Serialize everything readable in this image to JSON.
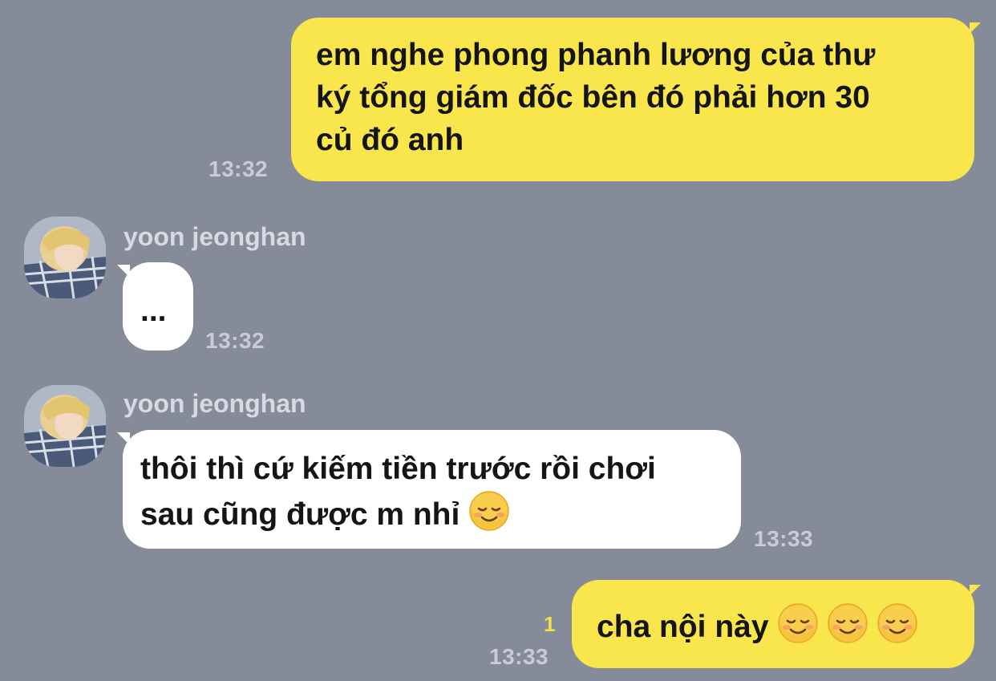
{
  "messages": [
    {
      "id": "m1",
      "direction": "outgoing",
      "text": "em nghe phong phanh lương của thư\nký tổng giám đốc bên đó phải hơn 30\ncủ đó anh",
      "time": "13:32"
    },
    {
      "id": "m2",
      "direction": "incoming",
      "sender": "yoon jeonghan",
      "text": "...",
      "time": "13:32"
    },
    {
      "id": "m3",
      "direction": "incoming",
      "sender": "yoon jeonghan",
      "text_line1": "thôi thì cứ kiếm tiền trước rồi chơi",
      "text_line2": "sau cũng được m nhỉ ",
      "emoji": "smiling-face-emoji",
      "time": "13:33"
    },
    {
      "id": "m4",
      "direction": "outgoing",
      "text": "cha nội này ",
      "emoji_count": 3,
      "emoji": "smiling-face-emoji",
      "unread_count": "1",
      "time": "13:33"
    }
  ],
  "colors": {
    "background": "#858b99",
    "outgoing_bubble": "#f9e54c",
    "incoming_bubble": "#ffffff",
    "timestamp": "#c8ccd6",
    "unread": "#f2e04b"
  }
}
